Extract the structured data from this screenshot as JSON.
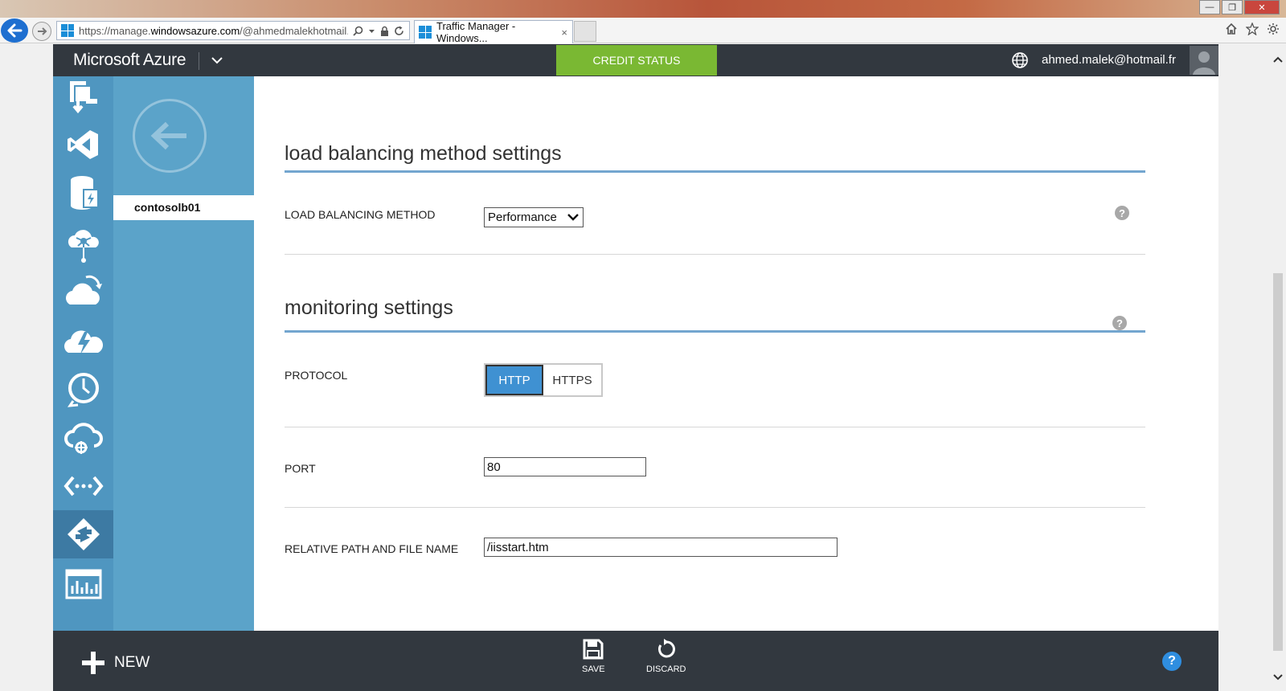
{
  "browser": {
    "url_prefix": "https://manage.",
    "url_domain": "windowsazure.com",
    "url_rest": "/@ahmedmalekhotmail.onmi",
    "tab_title": "Traffic Manager - Windows...",
    "tab_close": "×"
  },
  "header": {
    "brand": "Microsoft Azure",
    "credit_status": "CREDIT STATUS",
    "user_email": "ahmed.malek@hotmail.fr"
  },
  "subnav": {
    "item": "contosolb01"
  },
  "load_balancing": {
    "title": "load balancing method settings",
    "method_label": "LOAD BALANCING METHOD",
    "method_value": "Performance",
    "help": "?"
  },
  "monitoring": {
    "title": "monitoring settings",
    "help": "?",
    "protocol_label": "PROTOCOL",
    "protocol_options": [
      "HTTP",
      "HTTPS"
    ],
    "protocol_selected": "HTTP",
    "port_label": "PORT",
    "port_value": "80",
    "path_label": "RELATIVE PATH AND FILE NAME",
    "path_value": "/iisstart.htm"
  },
  "bottombar": {
    "new_label": "NEW",
    "save_label": "SAVE",
    "discard_label": "DISCARD",
    "help": "?"
  },
  "colors": {
    "header_bg": "#32383f",
    "credit_green": "#7ab833",
    "nav_blue": "#4f96c0",
    "subnav_blue": "#5ba3c9",
    "accent_blue": "#3f91d2"
  }
}
